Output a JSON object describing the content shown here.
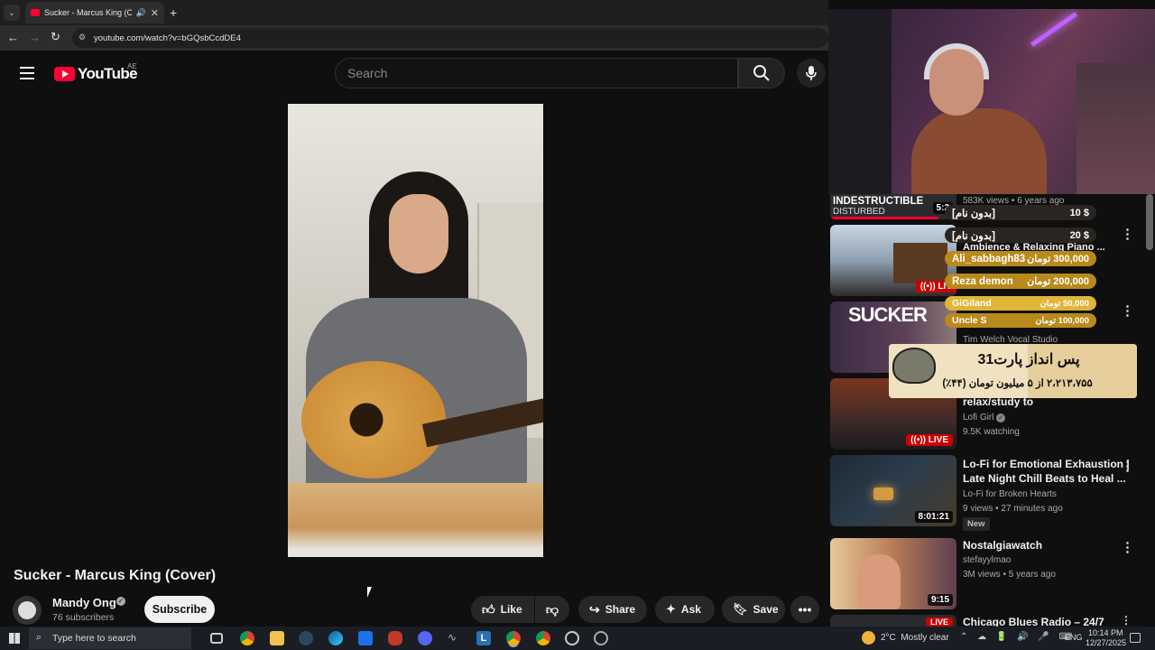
{
  "browser": {
    "tab_title": "Sucker - Marcus King (Cover)",
    "url": "youtube.com/watch?v=bGQsbCcdDE4",
    "colors": {
      "chrome_bg": "#1f1f1f",
      "tab_bg": "#2d2d2d"
    }
  },
  "header": {
    "logo_text": "YouTube",
    "country_code": "AE",
    "search_placeholder": "Search"
  },
  "video": {
    "title": "Sucker - Marcus King (Cover)",
    "channel": "Mandy Ong",
    "subscribers": "76 subscribers",
    "subscribe_label": "Subscribe",
    "actions": {
      "like": "Like",
      "share": "Share",
      "ask": "Ask",
      "save": "Save"
    }
  },
  "sidebar": {
    "items": [
      {
        "thumb_label": "INDESTRUCTIBLE",
        "thumb_sub": "DISTURBED",
        "duration": "5:2",
        "meta": "583K views • 6 years ago"
      },
      {
        "title": "Ambience & Relaxing Piano ...",
        "live": "LIV"
      },
      {
        "thumb_label": "SUCKER",
        "channel": "Tim Welch Vocal Studio"
      },
      {
        "title": "relax/study to",
        "channel": "Lofi Girl",
        "meta": "9.5K watching",
        "live": "LIVE"
      },
      {
        "title_line1": "Lo-Fi for Emotional Exhaustion |",
        "title_line2": "Late Night Chill Beats to Heal ...",
        "channel": "Lo-Fi for Broken Hearts",
        "meta": "9 views • 27 minutes ago",
        "badge": "New",
        "duration": "8:01:21"
      },
      {
        "title": "Nostalgiawatch",
        "channel": "stefayylmao",
        "meta": "3M views • 5 years ago",
        "duration": "9:15"
      },
      {
        "title": "Chicago Blues Radio – 24/7",
        "live": "LIVE"
      }
    ]
  },
  "donations": [
    {
      "name": "[بدون نام]",
      "amount": "$ 10",
      "color": "#7a5a14"
    },
    {
      "name": "[بدون نام]",
      "amount": "$ 20",
      "color": "#7a5a14"
    },
    {
      "name": "Ali_sabbagh83",
      "amount": "300,000 تومان",
      "color": "#c7961f"
    },
    {
      "name": "Reza demon",
      "amount": "200,000 تومان",
      "color": "#c7961f"
    },
    {
      "name": "GiGiland",
      "amount": "50,000 تومان",
      "color": "#e0b53a"
    },
    {
      "name": "Uncle S",
      "amount": "100,000 تومان",
      "color": "#c7961f"
    }
  ],
  "goal": {
    "title": "پس انداز پارت31",
    "progress": "۲،۲۱۳،۷۵۵ از ۵ میلیون تومان (۴۴٪)",
    "fraction": 0.44
  },
  "taskbar": {
    "search_placeholder": "Type here to search",
    "weather": "2°C  Mostly clear",
    "language": "ENG",
    "time": "10:14 PM",
    "date": "12/27/2025"
  }
}
